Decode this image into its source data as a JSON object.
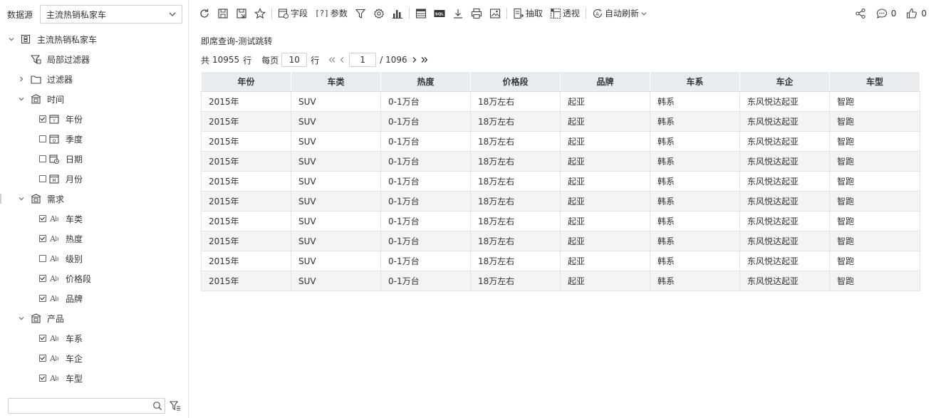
{
  "datasource": {
    "label": "数据源",
    "selected": "主流热销私家车"
  },
  "tree": {
    "root": "主流热销私家车",
    "local_filter": "局部过滤器",
    "filter": "过滤器",
    "time": {
      "label": "时间",
      "items": [
        {
          "label": "年份",
          "checked": true,
          "icon": "calendar-year-icon"
        },
        {
          "label": "季度",
          "checked": false,
          "icon": "calendar-quarter-icon"
        },
        {
          "label": "日期",
          "checked": false,
          "icon": "calendar-date-icon"
        },
        {
          "label": "月份",
          "checked": false,
          "icon": "calendar-month-icon"
        }
      ]
    },
    "demand": {
      "label": "需求",
      "items": [
        {
          "label": "车类",
          "checked": true
        },
        {
          "label": "热度",
          "checked": true
        },
        {
          "label": "级别",
          "checked": false
        },
        {
          "label": "价格段",
          "checked": true
        },
        {
          "label": "品牌",
          "checked": true
        }
      ]
    },
    "product": {
      "label": "产品",
      "items": [
        {
          "label": "车系",
          "checked": true
        },
        {
          "label": "车企",
          "checked": true
        },
        {
          "label": "车型",
          "checked": true
        }
      ]
    }
  },
  "search": {
    "placeholder": ""
  },
  "toolbar": {
    "field_label": "字段",
    "param_label": "参数",
    "sql_label": "SQL",
    "extract_label": "抽取",
    "pivot_label": "透视",
    "auto_refresh_label": "自动刷新",
    "comment_count": "0",
    "like_count": "0"
  },
  "report": {
    "title": "即席查询-测试跳转"
  },
  "pager": {
    "total_prefix": "共",
    "total": "10955",
    "row_unit": "行",
    "per_page_label": "每页",
    "per_page": "10",
    "row_unit2": "行",
    "current_page": "1",
    "total_pages": "/ 1096"
  },
  "table": {
    "headers": [
      "年份",
      "车类",
      "热度",
      "价格段",
      "品牌",
      "车系",
      "车企",
      "车型"
    ],
    "rows": [
      [
        "2015年",
        "SUV",
        "0-1万台",
        "18万左右",
        "起亚",
        "韩系",
        "东风悦达起亚",
        "智跑"
      ],
      [
        "2015年",
        "SUV",
        "0-1万台",
        "18万左右",
        "起亚",
        "韩系",
        "东风悦达起亚",
        "智跑"
      ],
      [
        "2015年",
        "SUV",
        "0-1万台",
        "18万左右",
        "起亚",
        "韩系",
        "东风悦达起亚",
        "智跑"
      ],
      [
        "2015年",
        "SUV",
        "0-1万台",
        "18万左右",
        "起亚",
        "韩系",
        "东风悦达起亚",
        "智跑"
      ],
      [
        "2015年",
        "SUV",
        "0-1万台",
        "18万左右",
        "起亚",
        "韩系",
        "东风悦达起亚",
        "智跑"
      ],
      [
        "2015年",
        "SUV",
        "0-1万台",
        "18万左右",
        "起亚",
        "韩系",
        "东风悦达起亚",
        "智跑"
      ],
      [
        "2015年",
        "SUV",
        "0-1万台",
        "18万左右",
        "起亚",
        "韩系",
        "东风悦达起亚",
        "智跑"
      ],
      [
        "2015年",
        "SUV",
        "0-1万台",
        "18万左右",
        "起亚",
        "韩系",
        "东风悦达起亚",
        "智跑"
      ],
      [
        "2015年",
        "SUV",
        "0-1万台",
        "18万左右",
        "起亚",
        "韩系",
        "东风悦达起亚",
        "智跑"
      ],
      [
        "2015年",
        "SUV",
        "0-1万台",
        "18万左右",
        "起亚",
        "韩系",
        "东风悦达起亚",
        "智跑"
      ]
    ]
  }
}
